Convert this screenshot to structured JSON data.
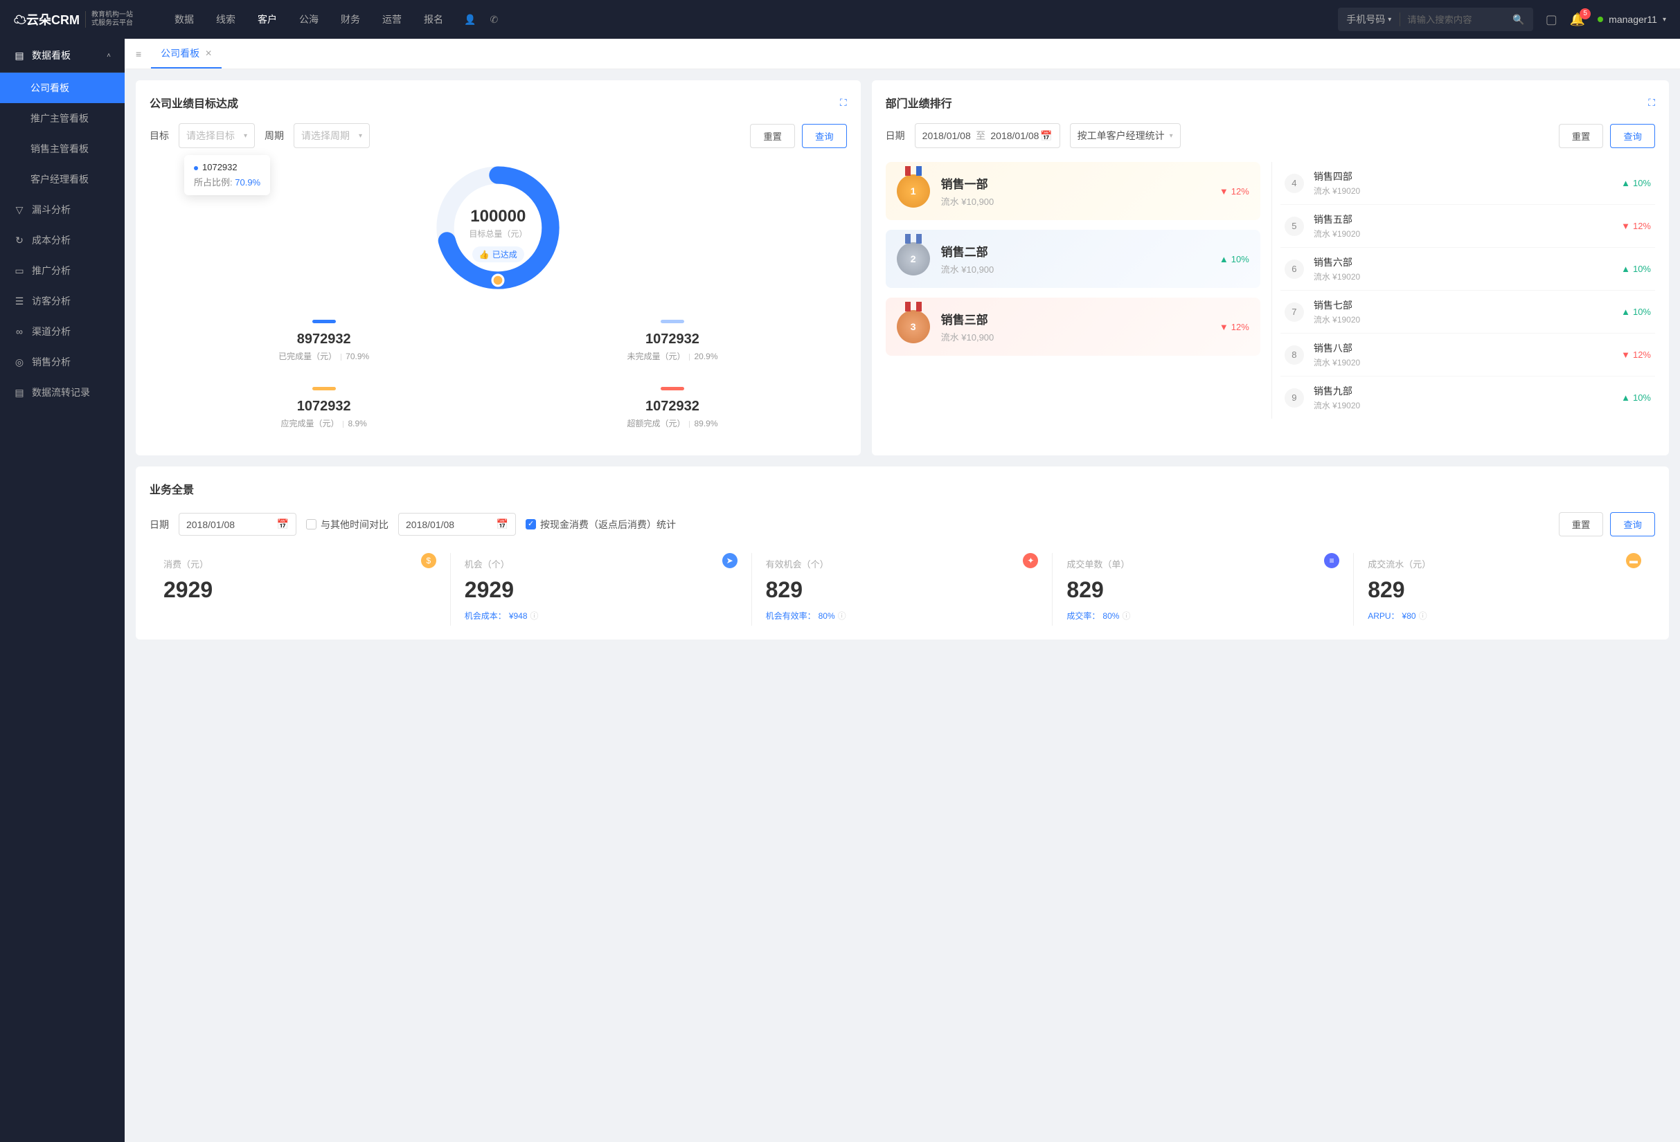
{
  "brand": {
    "name": "云朵CRM",
    "sub1": "教育机构一站",
    "sub2": "式服务云平台"
  },
  "mainnav": [
    "数据",
    "线索",
    "客户",
    "公海",
    "财务",
    "运营",
    "报名"
  ],
  "mainnav_active": 2,
  "search": {
    "type": "手机号码",
    "placeholder": "请输入搜索内容"
  },
  "notif_count": "5",
  "user": "manager11",
  "sidebar": {
    "group": "数据看板",
    "subs": [
      "公司看板",
      "推广主管看板",
      "销售主管看板",
      "客户经理看板"
    ],
    "active_sub": 0,
    "items": [
      {
        "icon": "▽",
        "label": "漏斗分析"
      },
      {
        "icon": "↻",
        "label": "成本分析"
      },
      {
        "icon": "▭",
        "label": "推广分析"
      },
      {
        "icon": "☰",
        "label": "访客分析"
      },
      {
        "icon": "∞",
        "label": "渠道分析"
      },
      {
        "icon": "◎",
        "label": "销售分析"
      },
      {
        "icon": "▤",
        "label": "数据流转记录"
      }
    ]
  },
  "tab": {
    "label": "公司看板"
  },
  "target_card": {
    "title": "公司业绩目标达成",
    "label_target": "目标",
    "ph_target": "请选择目标",
    "label_period": "周期",
    "ph_period": "请选择周期",
    "btn_reset": "重置",
    "btn_query": "查询",
    "tooltip_value": "1072932",
    "tooltip_ratio_label": "所占比例:",
    "tooltip_ratio": "70.9%",
    "center_value": "100000",
    "center_label": "目标总量（元）",
    "status": "已达成",
    "stats": [
      {
        "bar": "#2f7cff",
        "value": "8972932",
        "label": "已完成量（元）",
        "pct": "70.9%"
      },
      {
        "bar": "#a9c9ff",
        "value": "1072932",
        "label": "未完成量（元）",
        "pct": "20.9%"
      },
      {
        "bar": "#ffb84d",
        "value": "1072932",
        "label": "应完成量（元）",
        "pct": "8.9%"
      },
      {
        "bar": "#ff6b5c",
        "value": "1072932",
        "label": "超额完成（元）",
        "pct": "89.9%"
      }
    ]
  },
  "chart_data": {
    "type": "pie",
    "title": "公司业绩目标达成",
    "total_label": "目标总量（元）",
    "total_value": 100000,
    "series": [
      {
        "name": "已完成量（元）",
        "value": 8972932,
        "pct": 70.9,
        "color": "#2f7cff"
      },
      {
        "name": "未完成量（元）",
        "value": 1072932,
        "pct": 20.9,
        "color": "#a9c9ff"
      },
      {
        "name": "应完成量（元）",
        "value": 1072932,
        "pct": 8.9,
        "color": "#ffb84d"
      },
      {
        "name": "超额完成（元）",
        "value": 1072932,
        "pct": 89.9,
        "color": "#ff6b5c"
      }
    ],
    "highlighted": {
      "value": 1072932,
      "ratio_pct": 70.9
    }
  },
  "rank_card": {
    "title": "部门业绩排行",
    "label_date": "日期",
    "date1": "2018/01/08",
    "date_to": "至",
    "date2": "2018/01/08",
    "stat_by": "按工单客户经理统计",
    "btn_reset": "重置",
    "btn_query": "查询",
    "top": [
      {
        "name": "销售一部",
        "sub": "流水 ¥10,900",
        "pct": "12%",
        "dir": "down"
      },
      {
        "name": "销售二部",
        "sub": "流水 ¥10,900",
        "pct": "10%",
        "dir": "up"
      },
      {
        "name": "销售三部",
        "sub": "流水 ¥10,900",
        "pct": "12%",
        "dir": "down"
      }
    ],
    "rest": [
      {
        "n": "4",
        "name": "销售四部",
        "sub": "流水 ¥19020",
        "pct": "10%",
        "dir": "up"
      },
      {
        "n": "5",
        "name": "销售五部",
        "sub": "流水 ¥19020",
        "pct": "12%",
        "dir": "down"
      },
      {
        "n": "6",
        "name": "销售六部",
        "sub": "流水 ¥19020",
        "pct": "10%",
        "dir": "up"
      },
      {
        "n": "7",
        "name": "销售七部",
        "sub": "流水 ¥19020",
        "pct": "10%",
        "dir": "up"
      },
      {
        "n": "8",
        "name": "销售八部",
        "sub": "流水 ¥19020",
        "pct": "12%",
        "dir": "down"
      },
      {
        "n": "9",
        "name": "销售九部",
        "sub": "流水 ¥19020",
        "pct": "10%",
        "dir": "up"
      }
    ]
  },
  "pano_card": {
    "title": "业务全景",
    "label_date": "日期",
    "date1": "2018/01/08",
    "compare_label": "与其他时间对比",
    "date2": "2018/01/08",
    "check_label": "按现金消费（返点后消费）统计",
    "btn_reset": "重置",
    "btn_query": "查询",
    "kpis": [
      {
        "label": "消费（元）",
        "value": "2929",
        "sub": "",
        "icon": "ic-orange",
        "glyph": "$"
      },
      {
        "label": "机会（个）",
        "value": "2929",
        "sub_l": "机会成本：",
        "sub_v": "¥948",
        "icon": "ic-blue",
        "glyph": "➤"
      },
      {
        "label": "有效机会（个）",
        "value": "829",
        "sub_l": "机会有效率：",
        "sub_v": "80%",
        "icon": "ic-red",
        "glyph": "✦"
      },
      {
        "label": "成交单数（单）",
        "value": "829",
        "sub_l": "成交率：",
        "sub_v": "80%",
        "icon": "ic-purple",
        "glyph": "≡"
      },
      {
        "label": "成交流水（元）",
        "value": "829",
        "sub_l": "ARPU：",
        "sub_v": "¥80",
        "icon": "ic-yellow",
        "glyph": "▬"
      }
    ]
  }
}
